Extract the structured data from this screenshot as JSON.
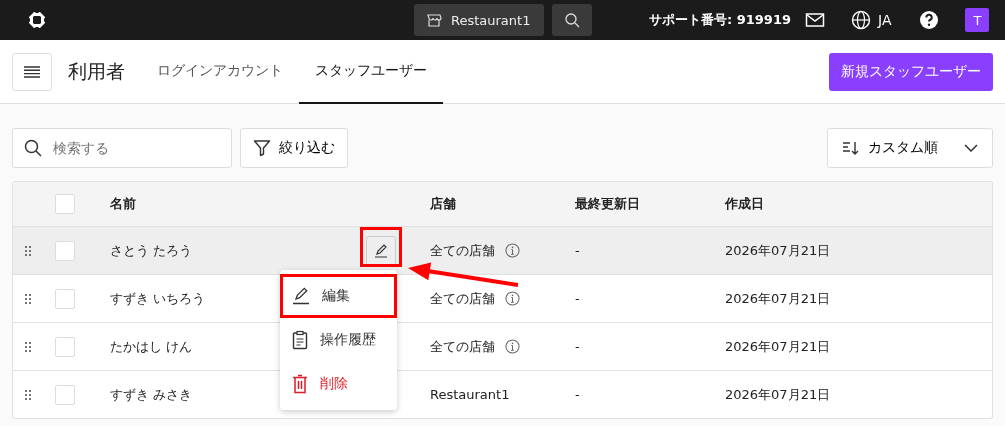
{
  "topbar": {
    "store": "Restaurant1",
    "support": "サポート番号: 919919",
    "language": "JA",
    "avatar": "T"
  },
  "header": {
    "title": "利用者",
    "tabs": [
      {
        "label": "ログインアカウント",
        "selected": false
      },
      {
        "label": "スタッフユーザー",
        "selected": true
      }
    ],
    "new_button": "新規スタッフユーザー"
  },
  "toolbar": {
    "search": {
      "placeholder": "検索する"
    },
    "filter": "絞り込む",
    "sort": "カスタム順"
  },
  "table": {
    "select_all_checked": false,
    "columns": [
      "名前",
      "店舗",
      "最終更新日",
      "作成日"
    ],
    "rows": [
      {
        "name": "さとう たろう",
        "store": "全ての店舗",
        "store_info": true,
        "updated": "-",
        "created": "2026年07月21日",
        "checked": false,
        "highlighted": true
      },
      {
        "name": "すずき いちろう",
        "store": "全ての店舗",
        "store_info": true,
        "updated": "-",
        "created": "2026年07月21日",
        "checked": false,
        "highlighted": false
      },
      {
        "name": "たかはし けん",
        "store": "全ての店舗",
        "store_info": true,
        "updated": "-",
        "created": "2026年07月21日",
        "checked": false,
        "highlighted": false
      },
      {
        "name": "すずき みさき",
        "store": "Restaurant1",
        "store_info": false,
        "updated": "-",
        "created": "2026年07月21日",
        "checked": false,
        "highlighted": false
      }
    ]
  },
  "menu": [
    {
      "kind": "edit",
      "label": "編集",
      "annotated": true
    },
    {
      "kind": "history",
      "label": "操作履歴",
      "annotated": false
    },
    {
      "kind": "delete",
      "label": "削除",
      "annotated": false
    }
  ]
}
